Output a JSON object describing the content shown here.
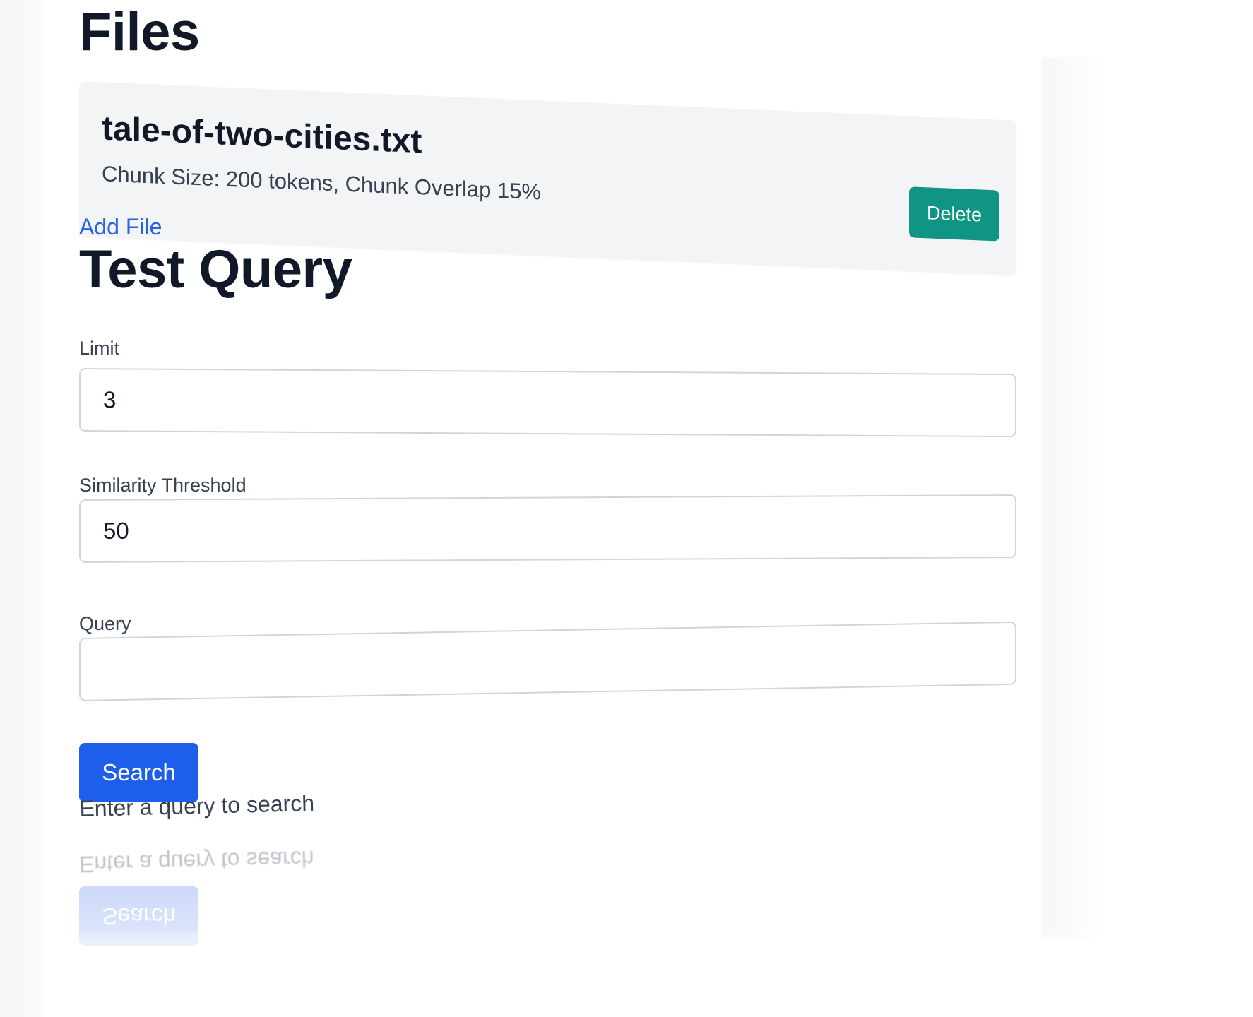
{
  "files_section": {
    "heading": "Files",
    "files": [
      {
        "name": "tale-of-two-cities.txt",
        "meta": "Chunk Size: 200 tokens, Chunk Overlap 15%",
        "delete_label": "Delete"
      }
    ],
    "add_file_label": "Add File"
  },
  "query_section": {
    "heading": "Test Query",
    "limit": {
      "label": "Limit",
      "value": "3"
    },
    "similarity": {
      "label": "Similarity Threshold",
      "value": "50"
    },
    "query": {
      "label": "Query",
      "value": ""
    },
    "search_label": "Search",
    "hint": "Enter a query to search"
  },
  "colors": {
    "delete_button": "#109584",
    "search_button": "#1d5fea",
    "link": "#2563eb",
    "card_bg": "#f3f4f6"
  }
}
